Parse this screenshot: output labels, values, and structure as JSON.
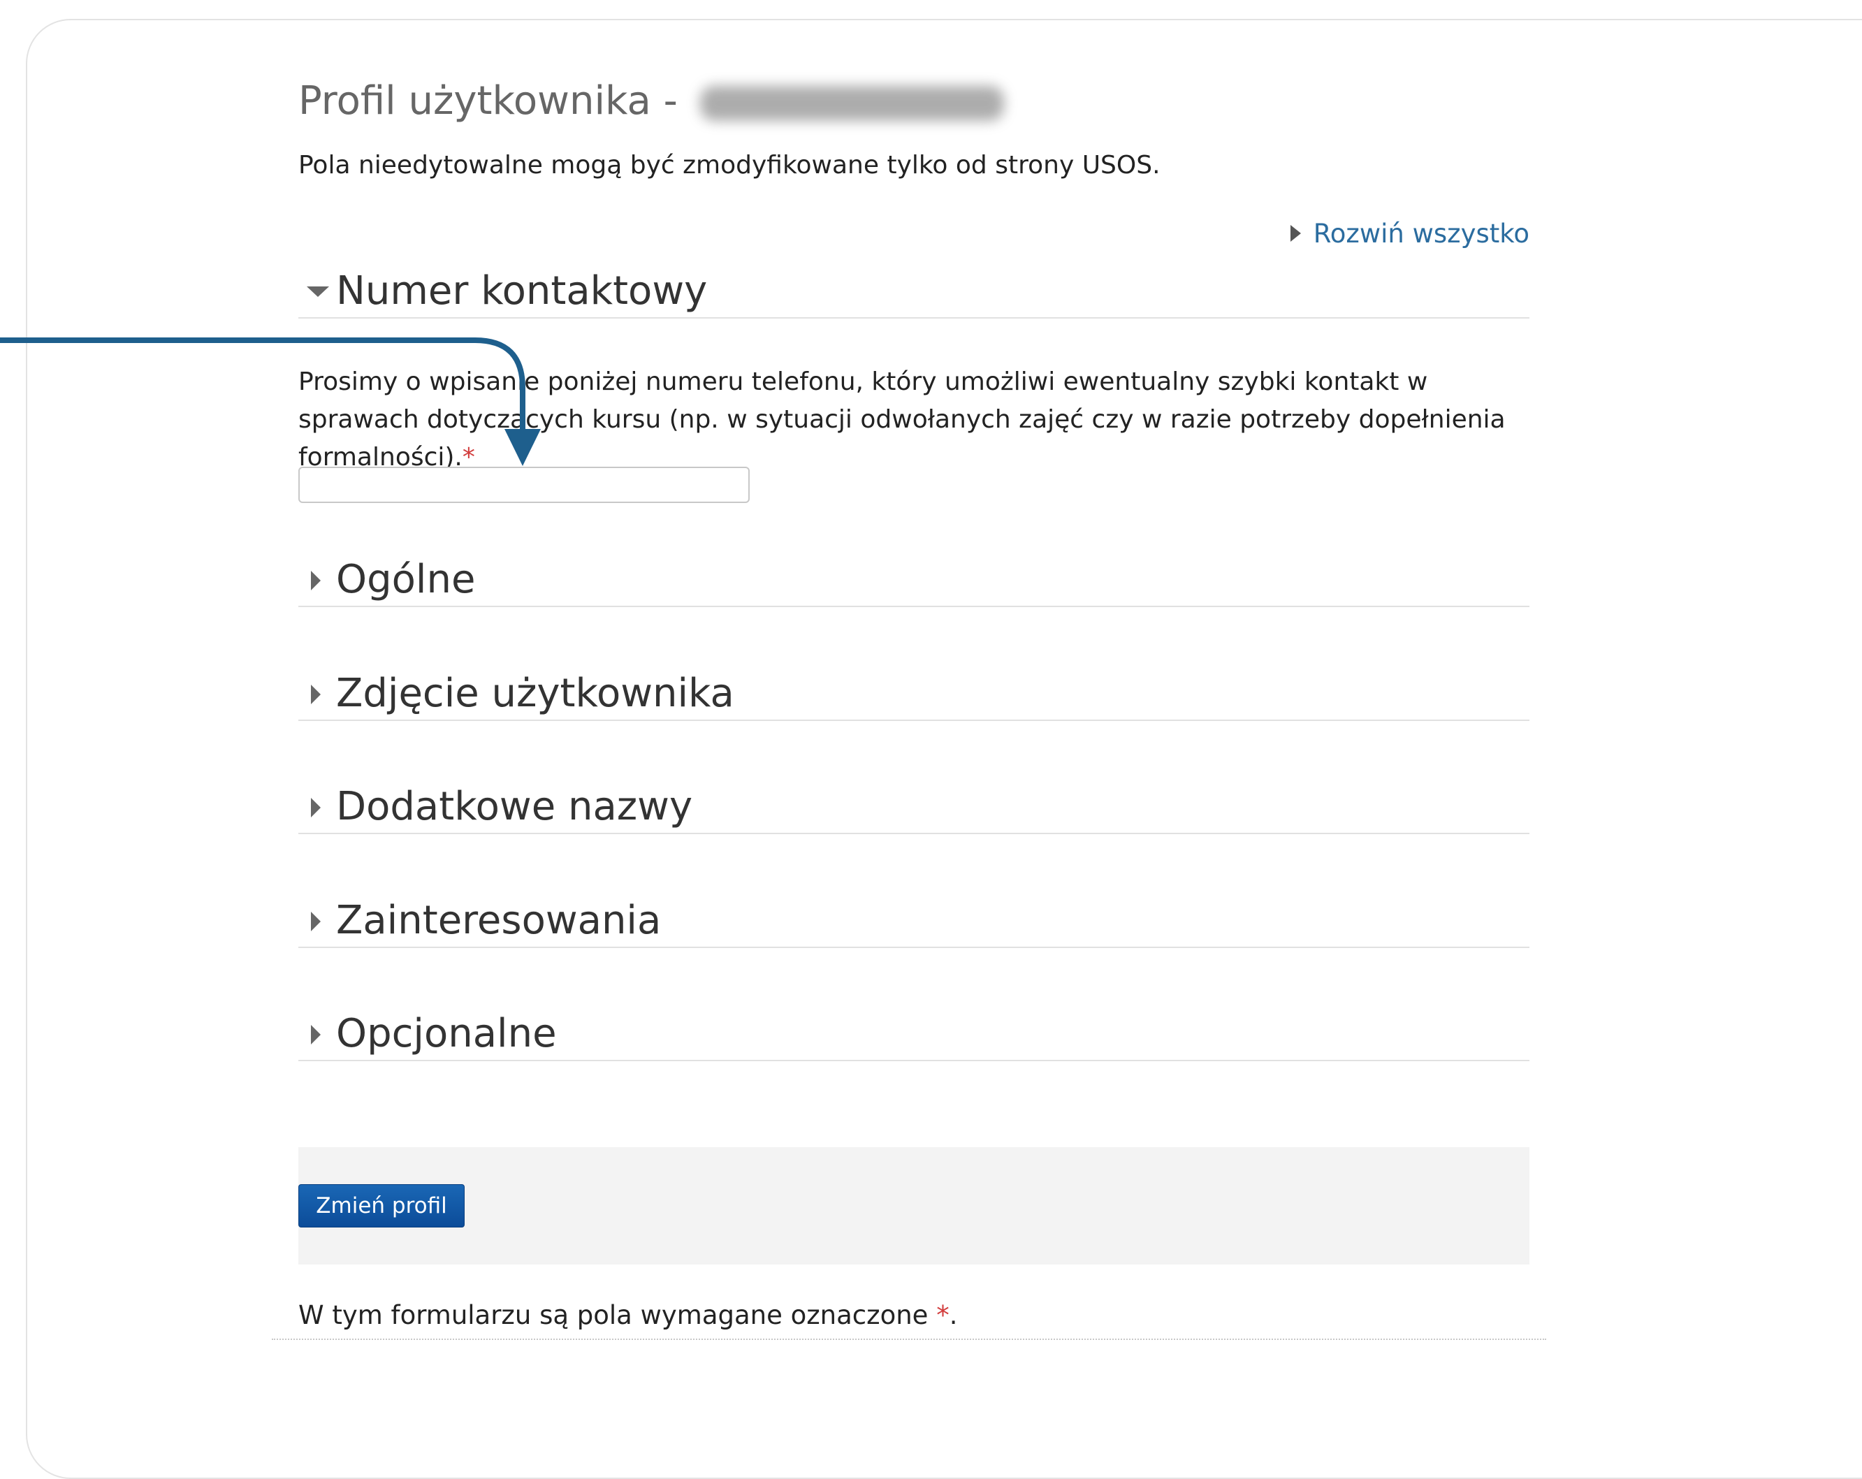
{
  "page": {
    "title": "Profil użytkownika -",
    "intro": "Pola nieedytowalne mogą być zmodyfikowane tylko od strony USOS.",
    "expand_all": "Rozwiń wszystko"
  },
  "contact_section": {
    "label": "Numer kontaktowy",
    "description": "Prosimy o wpisanie poniżej numeru telefonu, który umożliwi ewentualny szybki kontakt w sprawach dotyczących kursu (np. w sytuacji odwołanych zajęć czy w razie potrzeby dopełnienia formalności).",
    "required_mark": "*",
    "phone_value": ""
  },
  "sections": [
    {
      "label": "Ogólne"
    },
    {
      "label": "Zdjęcie użytkownika"
    },
    {
      "label": "Dodatkowe nazwy"
    },
    {
      "label": "Zainteresowania"
    },
    {
      "label": "Opcjonalne"
    }
  ],
  "submit": {
    "label": "Zmień profil"
  },
  "footer": {
    "note": "W tym formularzu są pola wymagane oznaczone",
    "required_mark": "*",
    "period": "."
  },
  "colors": {
    "link": "#2b6c9f",
    "button": "#0c4c99",
    "required": "#d23c3c",
    "arrow": "#1e5f8d"
  }
}
